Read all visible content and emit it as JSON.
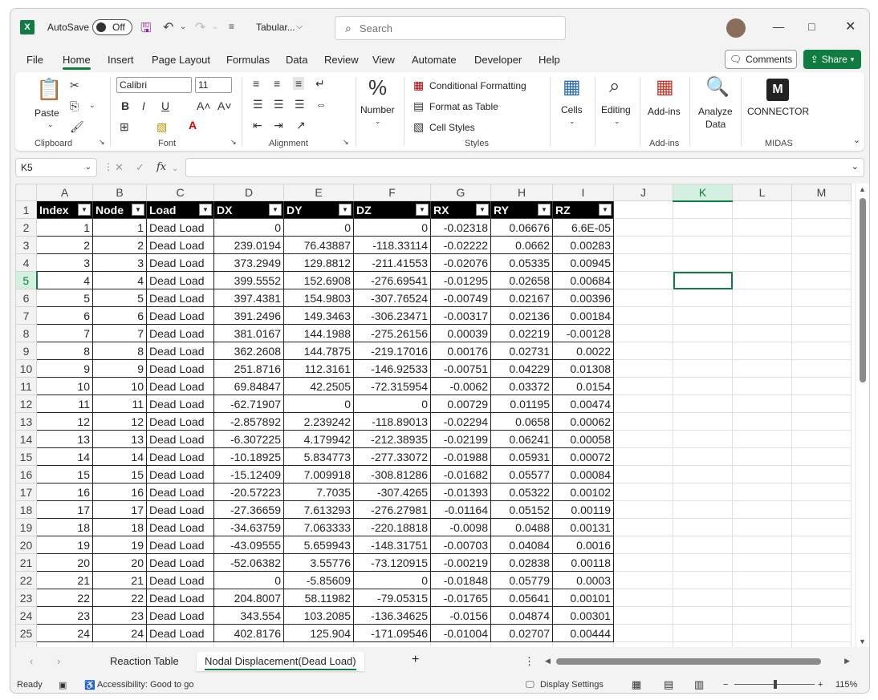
{
  "titlebar": {
    "autosave_label": "AutoSave",
    "toggle_state": "Off",
    "doc_title": "Tabular...",
    "search_placeholder": "Search"
  },
  "menu": [
    "File",
    "Home",
    "Insert",
    "Page Layout",
    "Formulas",
    "Data",
    "Review",
    "View",
    "Automate",
    "Developer",
    "Help"
  ],
  "menu_active": "Home",
  "actions": {
    "comments": "Comments",
    "share": "Share"
  },
  "ribbon": {
    "clipboard": {
      "paste": "Paste",
      "label": "Clipboard"
    },
    "font": {
      "name": "Calibri",
      "size": "11",
      "label": "Font"
    },
    "alignment": {
      "label": "Alignment"
    },
    "number": {
      "label": "Number"
    },
    "styles": {
      "conditional": "Conditional Formatting",
      "format_table": "Format as Table",
      "cell_styles": "Cell Styles",
      "label": "Styles"
    },
    "cells": "Cells",
    "editing": "Editing",
    "addins": {
      "button": "Add-ins",
      "label": "Add-ins"
    },
    "analyze": {
      "line1": "Analyze",
      "line2": "Data"
    },
    "midas": {
      "connector": "CONNECTOR",
      "label": "MIDAS"
    }
  },
  "formula_bar": {
    "name_box": "K5",
    "fx": "fx",
    "content": ""
  },
  "columns": [
    "A",
    "B",
    "C",
    "D",
    "E",
    "F",
    "G",
    "H",
    "I",
    "J",
    "K",
    "L",
    "M"
  ],
  "selected_column": "K",
  "selected_row": 5,
  "headers": [
    "Index",
    "Node",
    "Load",
    "DX",
    "DY",
    "DZ",
    "RX",
    "RY",
    "RZ"
  ],
  "rows": [
    [
      "1",
      "1",
      "Dead Load",
      "0",
      "0",
      "0",
      "-0.02318",
      "0.06676",
      "6.6E-05"
    ],
    [
      "2",
      "2",
      "Dead Load",
      "239.0194",
      "76.43887",
      "-118.33114",
      "-0.02222",
      "0.0662",
      "0.00283"
    ],
    [
      "3",
      "3",
      "Dead Load",
      "373.2949",
      "129.8812",
      "-211.41553",
      "-0.02076",
      "0.05335",
      "0.00945"
    ],
    [
      "4",
      "4",
      "Dead Load",
      "399.5552",
      "152.6908",
      "-276.69541",
      "-0.01295",
      "0.02658",
      "0.00684"
    ],
    [
      "5",
      "5",
      "Dead Load",
      "397.4381",
      "154.9803",
      "-307.76524",
      "-0.00749",
      "0.02167",
      "0.00396"
    ],
    [
      "6",
      "6",
      "Dead Load",
      "391.2496",
      "149.3463",
      "-306.23471",
      "-0.00317",
      "0.02136",
      "0.00184"
    ],
    [
      "7",
      "7",
      "Dead Load",
      "381.0167",
      "144.1988",
      "-275.26156",
      "0.00039",
      "0.02219",
      "-0.00128"
    ],
    [
      "8",
      "8",
      "Dead Load",
      "362.2608",
      "144.7875",
      "-219.17016",
      "0.00176",
      "0.02731",
      "0.0022"
    ],
    [
      "9",
      "9",
      "Dead Load",
      "251.8716",
      "112.3161",
      "-146.92533",
      "-0.00751",
      "0.04229",
      "0.01308"
    ],
    [
      "10",
      "10",
      "Dead Load",
      "69.84847",
      "42.2505",
      "-72.315954",
      "-0.0062",
      "0.03372",
      "0.0154"
    ],
    [
      "11",
      "11",
      "Dead Load",
      "-62.71907",
      "0",
      "0",
      "0.00729",
      "0.01195",
      "0.00474"
    ],
    [
      "12",
      "12",
      "Dead Load",
      "-2.857892",
      "2.239242",
      "-118.89013",
      "-0.02294",
      "0.0658",
      "0.00062"
    ],
    [
      "13",
      "13",
      "Dead Load",
      "-6.307225",
      "4.179942",
      "-212.38935",
      "-0.02199",
      "0.06241",
      "0.00058"
    ],
    [
      "14",
      "14",
      "Dead Load",
      "-10.18925",
      "5.834773",
      "-277.33072",
      "-0.01988",
      "0.05931",
      "0.00072"
    ],
    [
      "15",
      "15",
      "Dead Load",
      "-15.12409",
      "7.009918",
      "-308.81286",
      "-0.01682",
      "0.05577",
      "0.00084"
    ],
    [
      "16",
      "16",
      "Dead Load",
      "-20.57223",
      "7.7035",
      "-307.4265",
      "-0.01393",
      "0.05322",
      "0.00102"
    ],
    [
      "17",
      "17",
      "Dead Load",
      "-27.36659",
      "7.613293",
      "-276.27981",
      "-0.01164",
      "0.05152",
      "0.00119"
    ],
    [
      "18",
      "18",
      "Dead Load",
      "-34.63759",
      "7.063333",
      "-220.18818",
      "-0.0098",
      "0.0488",
      "0.00131"
    ],
    [
      "19",
      "19",
      "Dead Load",
      "-43.09555",
      "5.659943",
      "-148.31751",
      "-0.00703",
      "0.04084",
      "0.0016"
    ],
    [
      "20",
      "20",
      "Dead Load",
      "-52.06382",
      "3.55776",
      "-73.120915",
      "-0.00219",
      "0.02838",
      "0.00118"
    ],
    [
      "21",
      "21",
      "Dead Load",
      "0",
      "-5.85609",
      "0",
      "-0.01848",
      "0.05779",
      "0.0003"
    ],
    [
      "22",
      "22",
      "Dead Load",
      "204.8007",
      "58.11982",
      "-79.05315",
      "-0.01765",
      "0.05641",
      "0.00101"
    ],
    [
      "23",
      "23",
      "Dead Load",
      "343.554",
      "103.2085",
      "-136.34625",
      "-0.0156",
      "0.04874",
      "0.00301"
    ],
    [
      "24",
      "24",
      "Dead Load",
      "402.8176",
      "125.904",
      "-171.09546",
      "-0.01004",
      "0.02707",
      "0.00444"
    ]
  ],
  "sheets": [
    "Reaction Table",
    "Nodal Displacement(Dead Load)"
  ],
  "active_sheet": "Nodal Displacement(Dead Load)",
  "status": {
    "ready": "Ready",
    "accessibility": "Accessibility: Good to go",
    "display_settings": "Display Settings",
    "zoom": "115%"
  },
  "colors": {
    "accent": "#107c41",
    "header_bg": "#000000",
    "header_fg": "#ffffff"
  }
}
